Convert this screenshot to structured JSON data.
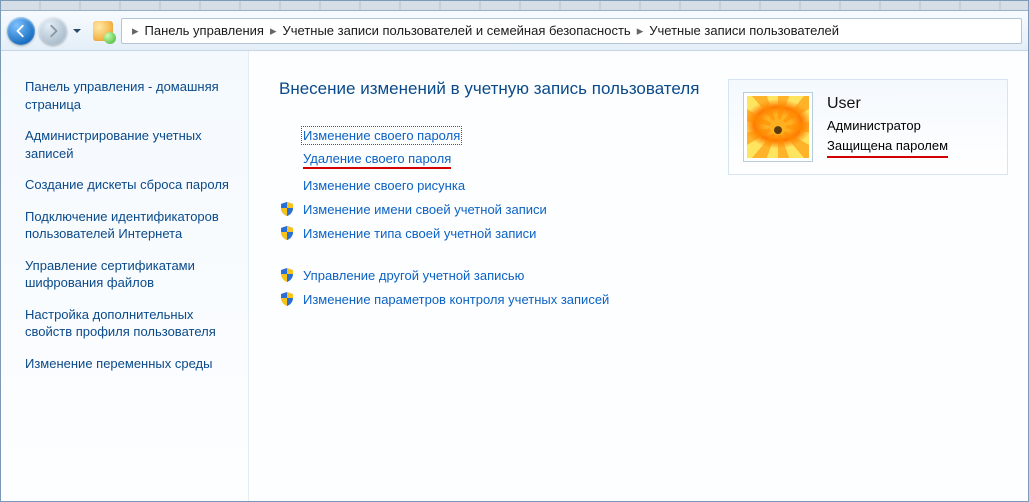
{
  "breadcrumb": {
    "seg1": "Панель управления",
    "seg2": "Учетные записи пользователей и семейная безопасность",
    "seg3": "Учетные записи пользователей"
  },
  "sidebar": {
    "items": [
      "Панель управления - домашняя страница",
      "Администрирование учетных записей",
      "Создание дискеты сброса пароля",
      "Подключение идентификаторов пользователей Интернета",
      "Управление сертификатами шифрования файлов",
      "Настройка дополнительных свойств профиля пользователя",
      "Изменение переменных среды"
    ]
  },
  "page": {
    "title": "Внесение изменений в учетную запись пользователя"
  },
  "actions": {
    "a0": "Изменение своего пароля",
    "a1": "Удаление своего пароля",
    "a2": "Изменение своего рисунка",
    "a3": "Изменение имени своей учетной записи",
    "a4": "Изменение типа своей учетной записи",
    "a5": "Управление другой учетной записью",
    "a6": "Изменение параметров контроля учетных записей"
  },
  "user": {
    "name": "User",
    "role": "Администратор",
    "protected": "Защищена паролем"
  }
}
